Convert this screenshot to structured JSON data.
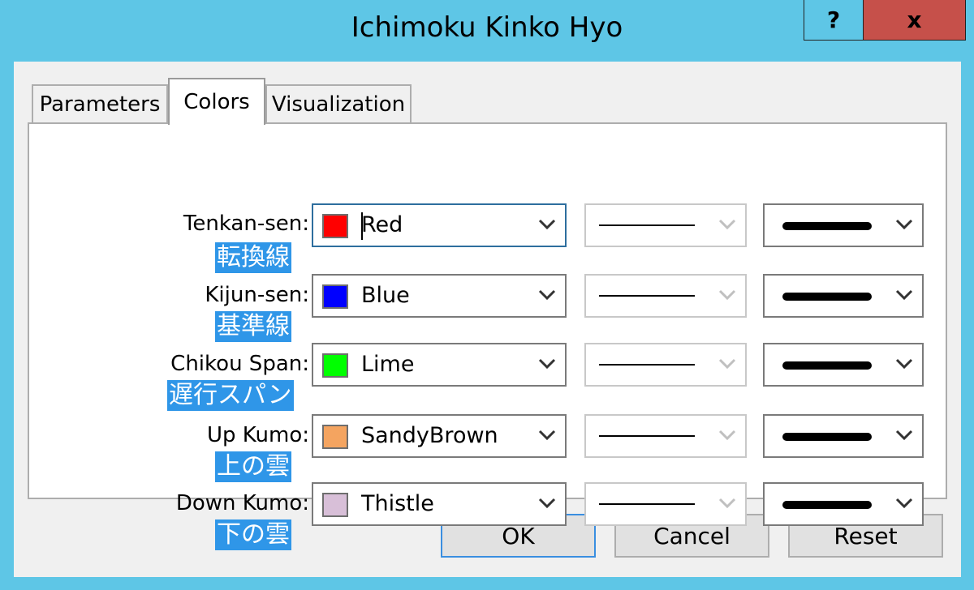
{
  "window": {
    "title": "Ichimoku Kinko Hyo",
    "help_label": "?",
    "close_label": "x"
  },
  "tabs": [
    {
      "label": "Parameters",
      "active": false
    },
    {
      "label": "Colors",
      "active": true
    },
    {
      "label": "Visualization",
      "active": false
    }
  ],
  "rows": [
    {
      "label": "Tenkan-sen:",
      "jp": "転換線",
      "color_name": "Red",
      "color": "#ff0000",
      "focused": true
    },
    {
      "label": "Kijun-sen:",
      "jp": "基準線",
      "color_name": "Blue",
      "color": "#0000ff",
      "focused": false
    },
    {
      "label": "Chikou Span:",
      "jp": "遅行スパン",
      "color_name": "Lime",
      "color": "#00ff00",
      "focused": false
    },
    {
      "label": "Up Kumo:",
      "jp": "上の雲",
      "color_name": "SandyBrown",
      "color": "#f4a460",
      "focused": false
    },
    {
      "label": "Down Kumo:",
      "jp": "下の雲",
      "color_name": "Thistle",
      "color": "#d8bfd8",
      "focused": false
    }
  ],
  "buttons": {
    "ok": "OK",
    "cancel": "Cancel",
    "reset": "Reset"
  },
  "colors": {
    "window_frame": "#5ec6e6",
    "close_button": "#c6504a",
    "annotation_highlight": "#2f96e8"
  }
}
